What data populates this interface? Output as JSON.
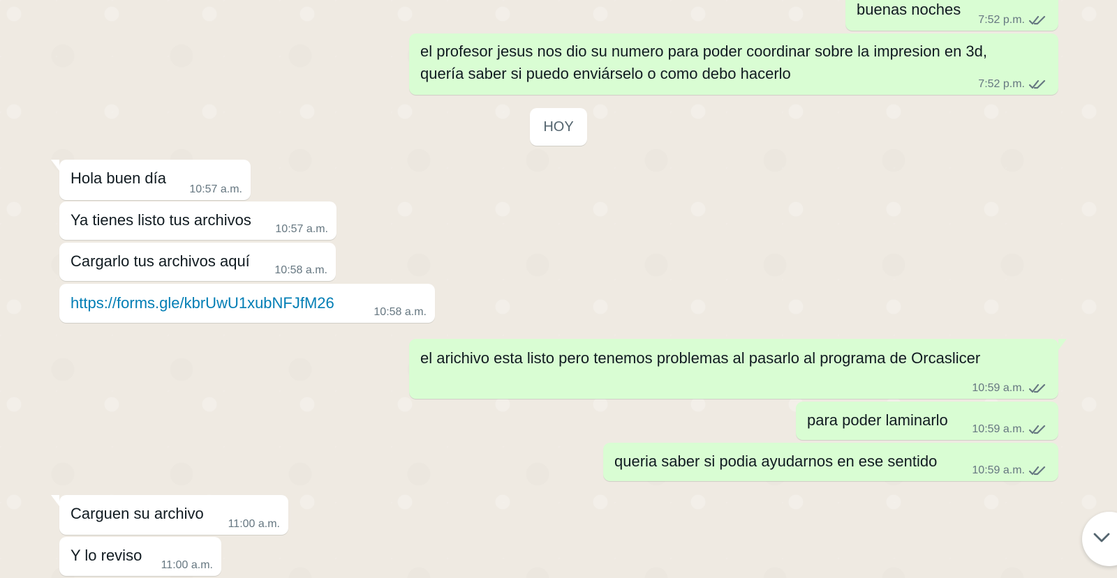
{
  "chat": {
    "date_separator": "HOY",
    "messages": [
      {
        "text": "buenas noches",
        "time": "7:52 p.m."
      },
      {
        "text": "el profesor jesus nos dio su numero para poder coordinar sobre la impresion en 3d, quería saber si puedo enviárselo o como debo hacerlo",
        "time": "7:52 p.m."
      },
      {
        "text": "Hola buen día",
        "time": "10:57 a.m."
      },
      {
        "text": "Ya tienes listo tus archivos",
        "time": "10:57 a.m."
      },
      {
        "text": "Cargarlo tus archivos aquí",
        "time": "10:58 a.m."
      },
      {
        "text": "https://forms.gle/kbrUwU1xubNFJfM26",
        "time": "10:58 a.m."
      },
      {
        "text": "el arichivo esta listo pero tenemos problemas al pasarlo al programa de Orcaslicer",
        "time": "10:59 a.m."
      },
      {
        "text": "para poder laminarlo",
        "time": "10:59 a.m."
      },
      {
        "text": "queria saber si podia ayudarnos en ese sentido",
        "time": "10:59 a.m."
      },
      {
        "text": "Carguen su archivo",
        "time": "11:00 a.m."
      },
      {
        "text": "Y lo reviso",
        "time": "11:00 a.m."
      }
    ]
  },
  "icons": {
    "read_receipt": "double-check-icon",
    "scroll_down": "chevron-down-icon"
  },
  "colors": {
    "chat_background": "#efeae2",
    "incoming_bubble": "#ffffff",
    "outgoing_bubble": "#d9fdd3",
    "link": "#027eb5",
    "meta_text": "#667781"
  }
}
